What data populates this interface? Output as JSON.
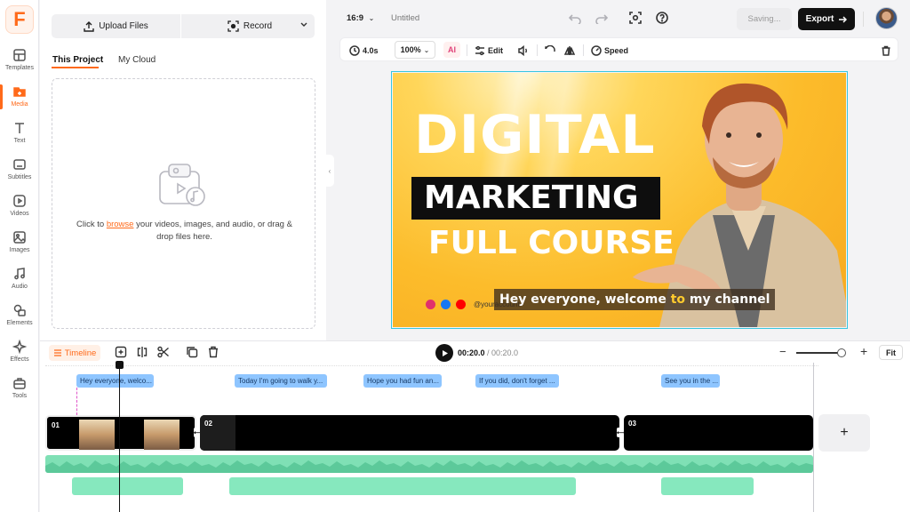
{
  "app": {
    "logo_letter": "F"
  },
  "rail": {
    "items": [
      {
        "label": "Templates",
        "icon": "templates-icon"
      },
      {
        "label": "Media",
        "icon": "media-icon"
      },
      {
        "label": "Text",
        "icon": "text-icon"
      },
      {
        "label": "Subtitles",
        "icon": "subtitles-icon"
      },
      {
        "label": "Videos",
        "icon": "videos-icon"
      },
      {
        "label": "Images",
        "icon": "images-icon"
      },
      {
        "label": "Audio",
        "icon": "audio-icon"
      },
      {
        "label": "Elements",
        "icon": "elements-icon"
      },
      {
        "label": "Effects",
        "icon": "effects-icon"
      },
      {
        "label": "Tools",
        "icon": "tools-icon"
      }
    ],
    "active": "Media"
  },
  "panel": {
    "upload_label": "Upload Files",
    "record_label": "Record",
    "tabs": [
      "This Project",
      "My Cloud"
    ],
    "drop_prefix": "Click to ",
    "drop_link": "browse",
    "drop_suffix": " your videos, images, and audio, or drag & drop files here."
  },
  "topbar": {
    "aspect": "16:9",
    "title": "Untitled",
    "saving": "Saving...",
    "export": "Export"
  },
  "toolbar": {
    "duration": "4.0s",
    "zoom": "100%",
    "ai": "AI",
    "edit": "Edit",
    "speed": "Speed"
  },
  "canvas": {
    "line1": "DIGITAL",
    "line2": "MARKETING",
    "line3": "FULL COURSE",
    "handle": "@youraccount",
    "subtitle_before": "Hey everyone, welcome ",
    "subtitle_highlight": "to",
    "subtitle_after": " my channel",
    "highlight_color": "#ffcc2e",
    "accent": "#ff6a1a"
  },
  "timeline": {
    "label": "Timeline",
    "time_current": "00:20.0",
    "time_total": " / 00:20.0",
    "fit": "Fit",
    "subtitles": [
      "Hey everyone, welco...",
      "Today I'm going to walk y...",
      "Hope you had fun an...",
      "If you did, don't forget ...",
      "See you in the ..."
    ],
    "clips": [
      "01",
      "02",
      "03"
    ]
  }
}
